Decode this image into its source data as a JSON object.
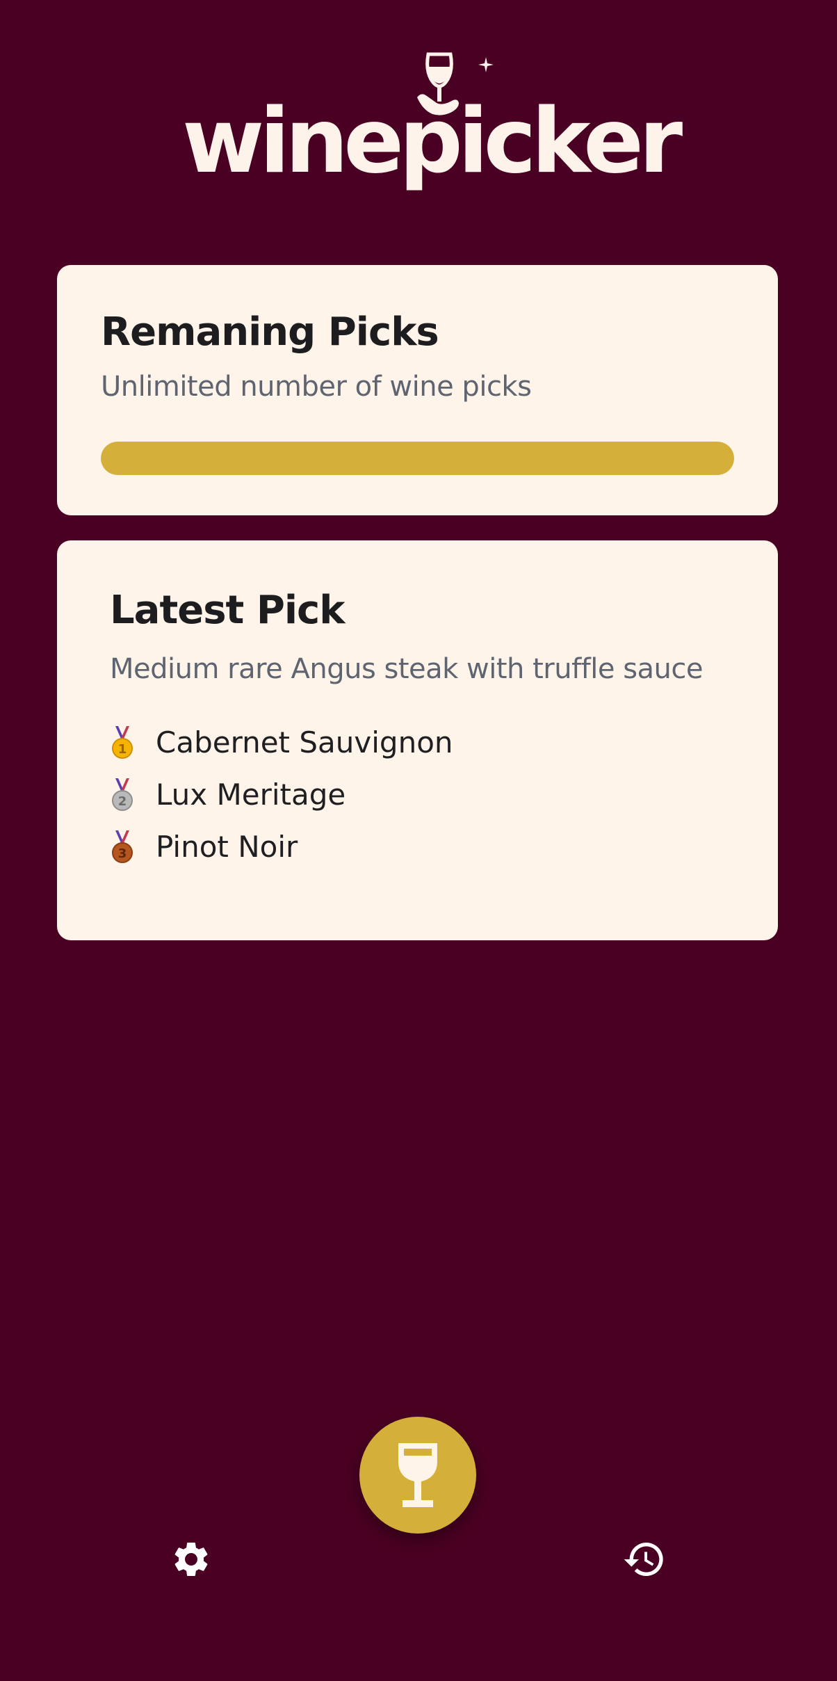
{
  "app": {
    "name": "winepicker"
  },
  "colors": {
    "background": "#4a0022",
    "card": "#fff4ea",
    "accent": "#d4b03a",
    "logo": "#fdf3ea"
  },
  "remaining_picks": {
    "title": "Remaning Picks",
    "subtitle": "Unlimited number of wine picks",
    "progress": 1.0
  },
  "latest_pick": {
    "title": "Latest Pick",
    "dish": "Medium rare Angus steak with truffle sauce",
    "wines": [
      {
        "rank": "1",
        "medal_icon": "gold-medal-icon",
        "name": "Cabernet Sauvignon"
      },
      {
        "rank": "2",
        "medal_icon": "silver-medal-icon",
        "name": "Lux Meritage"
      },
      {
        "rank": "3",
        "medal_icon": "bronze-medal-icon",
        "name": "Pinot Noir"
      }
    ]
  },
  "nav": {
    "settings_icon": "gear-icon",
    "pick_icon": "wine-glass-icon",
    "history_icon": "history-icon"
  }
}
